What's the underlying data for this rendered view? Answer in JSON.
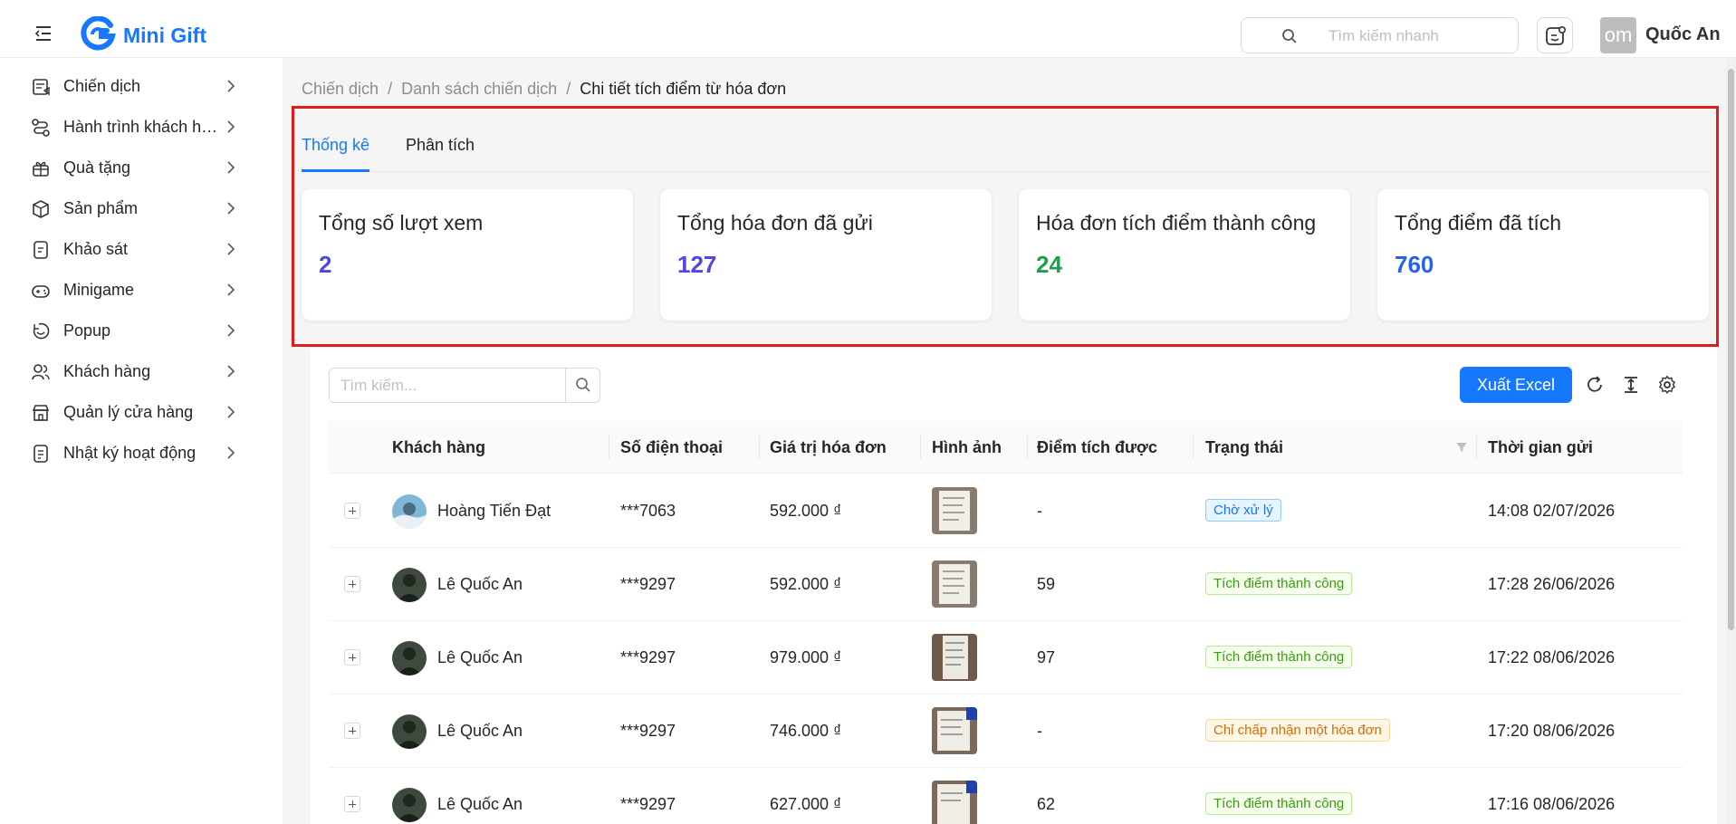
{
  "header": {
    "brand": "Mini Gift",
    "search_placeholder": "Tìm kiếm nhanh",
    "avatar_text": "om",
    "user_name": "Quốc An"
  },
  "sidebar": {
    "items": [
      {
        "label": "Chiến dịch",
        "icon": "megaphone-icon"
      },
      {
        "label": "Hành trình khách hàng",
        "icon": "route-icon"
      },
      {
        "label": "Quà tặng",
        "icon": "gift-icon"
      },
      {
        "label": "Sản phẩm",
        "icon": "box-icon"
      },
      {
        "label": "Khảo sát",
        "icon": "survey-icon"
      },
      {
        "label": "Minigame",
        "icon": "gamepad-icon"
      },
      {
        "label": "Popup",
        "icon": "popup-icon"
      },
      {
        "label": "Khách hàng",
        "icon": "users-icon"
      },
      {
        "label": "Quản lý cửa hàng",
        "icon": "store-icon"
      },
      {
        "label": "Nhật ký hoạt động",
        "icon": "log-icon"
      }
    ]
  },
  "breadcrumb": {
    "items": [
      "Chiến dịch",
      "Danh sách chiến dịch",
      "Chi tiết tích điểm từ hóa đơn"
    ],
    "separator": "/"
  },
  "tabs": [
    {
      "label": "Thống kê",
      "active": true
    },
    {
      "label": "Phân tích",
      "active": false
    }
  ],
  "stats": [
    {
      "title": "Tổng số lượt xem",
      "value": "2",
      "color": "#4f46e5"
    },
    {
      "title": "Tổng hóa đơn đã gửi",
      "value": "127",
      "color": "#4f46e5"
    },
    {
      "title": "Hóa đơn tích điểm thành công",
      "value": "24",
      "color": "#16a34a"
    },
    {
      "title": "Tổng điểm đã tích",
      "value": "760",
      "color": "#2563eb"
    }
  ],
  "table": {
    "search_placeholder": "Tìm kiếm...",
    "export_label": "Xuất Excel",
    "columns": [
      "Khách hàng",
      "Số điện thoại",
      "Giá trị hóa đơn",
      "Hình ảnh",
      "Điểm tích được",
      "Trạng thái",
      "Thời gian gửi"
    ],
    "rows": [
      {
        "name": "Hoàng Tiến Đạt",
        "phone": "***7063",
        "amount": "592.000 ₫",
        "points": "-",
        "status": "Chờ xử lý",
        "status_type": "pending",
        "time": "14:08 02/07/2026"
      },
      {
        "name": "Lê Quốc An",
        "phone": "***9297",
        "amount": "592.000 ₫",
        "points": "59",
        "status": "Tích điểm thành công",
        "status_type": "success",
        "time": "17:28 26/06/2026"
      },
      {
        "name": "Lê Quốc An",
        "phone": "***9297",
        "amount": "979.000 ₫",
        "points": "97",
        "status": "Tích điểm thành công",
        "status_type": "success",
        "time": "17:22 08/06/2026"
      },
      {
        "name": "Lê Quốc An",
        "phone": "***9297",
        "amount": "746.000 ₫",
        "points": "-",
        "status": "Chỉ chấp nhận một hóa đơn",
        "status_type": "warning",
        "time": "17:20 08/06/2026"
      },
      {
        "name": "Lê Quốc An",
        "phone": "***9297",
        "amount": "627.000 ₫",
        "points": "62",
        "status": "Tích điểm thành công",
        "status_type": "success",
        "time": "17:16 08/06/2026"
      }
    ]
  },
  "colors": {
    "primary": "#1677ff",
    "highlight_border": "#e01b1b"
  }
}
